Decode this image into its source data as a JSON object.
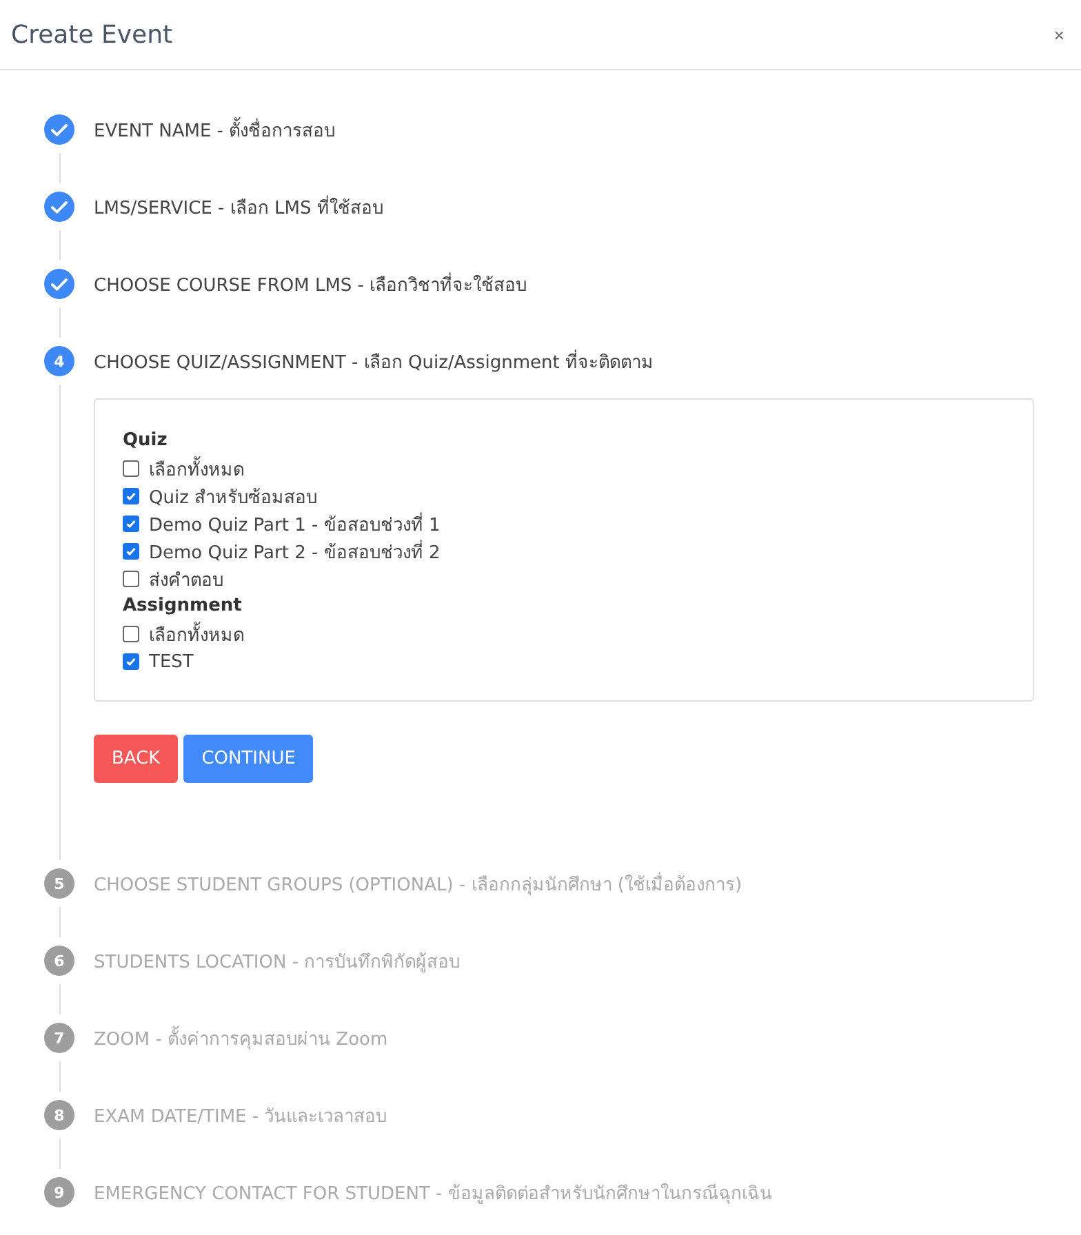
{
  "window": {
    "title": "Create Event",
    "close": "×"
  },
  "steps": [
    {
      "completed": true,
      "active": false,
      "label": "EVENT NAME - ตั้งชื่อการสอบ"
    },
    {
      "completed": true,
      "active": false,
      "label": "LMS/SERVICE - เลือก LMS ที่ใช้สอบ"
    },
    {
      "completed": true,
      "active": false,
      "label": "CHOOSE COURSE FROM LMS - เลือกวิชาที่จะใช้สอบ"
    },
    {
      "completed": false,
      "active": true,
      "number": "4",
      "label": "CHOOSE QUIZ/ASSIGNMENT - เลือก Quiz/Assignment ที่จะติดตาม",
      "groups": [
        {
          "heading": "Quiz",
          "options": [
            {
              "label": "เลือกทั้งหมด",
              "checked": false
            },
            {
              "label": "Quiz สำหรับซ้อมสอบ",
              "checked": true
            },
            {
              "label": "Demo Quiz Part 1 - ข้อสอบช่วงที่ 1",
              "checked": true
            },
            {
              "label": "Demo Quiz Part 2 - ข้อสอบช่วงที่ 2",
              "checked": true
            },
            {
              "label": "ส่งคำตอบ",
              "checked": false
            }
          ]
        },
        {
          "heading": "Assignment",
          "options": [
            {
              "label": "เลือกทั้งหมด",
              "checked": false
            },
            {
              "label": "TEST",
              "checked": true
            }
          ]
        }
      ],
      "buttons": [
        {
          "kind": "back",
          "label": "BACK"
        },
        {
          "kind": "continue",
          "label": "CONTINUE"
        }
      ]
    },
    {
      "completed": false,
      "active": false,
      "number": "5",
      "label": "CHOOSE STUDENT GROUPS (OPTIONAL) - เลือกกลุ่มนักศึกษา (ใช้เมื่อต้องการ)"
    },
    {
      "completed": false,
      "active": false,
      "number": "6",
      "label": "STUDENTS LOCATION - การบันทึกพิกัดผู้สอบ"
    },
    {
      "completed": false,
      "active": false,
      "number": "7",
      "label": "ZOOM - ตั้งค่าการคุมสอบผ่าน Zoom"
    },
    {
      "completed": false,
      "active": false,
      "number": "8",
      "label": "EXAM DATE/TIME - วันและเวลาสอบ"
    },
    {
      "completed": false,
      "active": false,
      "number": "9",
      "label": "EMERGENCY CONTACT FOR STUDENT - ข้อมูลติดต่อสำหรับนักศึกษาในกรณีฉุกเฉิน"
    }
  ]
}
